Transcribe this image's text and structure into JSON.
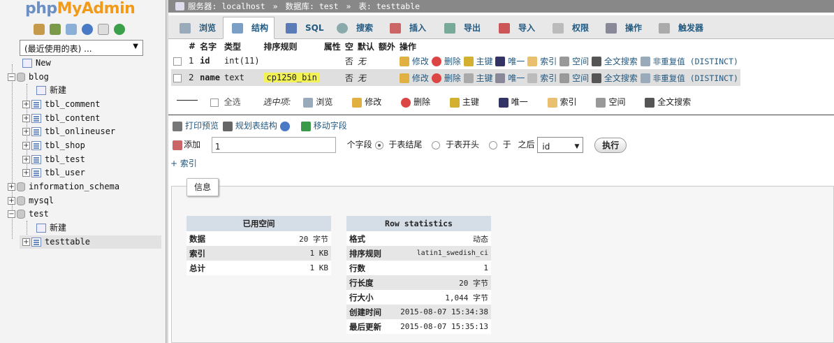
{
  "logo": {
    "php": "php",
    "my": "MyAdmin"
  },
  "nav": {
    "db_select": "(最近使用的表) ..."
  },
  "tree": [
    {
      "label": "New"
    },
    {
      "label": "blog"
    },
    {
      "label": "新建"
    },
    {
      "label": "tbl_comment"
    },
    {
      "label": "tbl_content"
    },
    {
      "label": "tbl_onlineuser"
    },
    {
      "label": "tbl_shop"
    },
    {
      "label": "tbl_test"
    },
    {
      "label": "tbl_user"
    },
    {
      "label": "information_schema"
    },
    {
      "label": "mysql"
    },
    {
      "label": "test"
    },
    {
      "label": "新建"
    },
    {
      "label": "testtable"
    }
  ],
  "breadcrumb": {
    "server": "服务器: localhost",
    "database": "数据库: test",
    "table": "表: testtable",
    "sep": "»"
  },
  "tabs": [
    "浏览",
    "结构",
    "SQL",
    "搜索",
    "插入",
    "导出",
    "导入",
    "权限",
    "操作",
    "触发器"
  ],
  "columns": [
    "#",
    "名字",
    "类型",
    "排序规则",
    "属性",
    "空",
    "默认",
    "额外",
    "操作"
  ],
  "rows": [
    {
      "num": "1",
      "name": "id",
      "type": "int(11)",
      "collation": "",
      "attr": "",
      "null": "否",
      "default": "无",
      "extra": ""
    },
    {
      "num": "2",
      "name": "name",
      "type": "text",
      "collation": "cp1250_bin",
      "attr": "",
      "null": "否",
      "default": "无",
      "extra": ""
    }
  ],
  "row_actions": {
    "edit": "修改",
    "drop": "删除",
    "primary": "主键",
    "unique": "唯一",
    "index": "索引",
    "spatial": "空间",
    "fulltext": "全文搜索",
    "distinct": "非重复值 (DISTINCT)"
  },
  "bulk": {
    "check_all": "全选",
    "with_selected": "选中项:",
    "browse": "浏览",
    "edit": "修改",
    "drop": "删除",
    "primary": "主键",
    "unique": "唯一",
    "index": "索引",
    "spatial": "空间",
    "fulltext": "全文搜索"
  },
  "links": {
    "print": "打印预览",
    "propose": "规划表结构",
    "move": "移动字段"
  },
  "add": {
    "label": "添加",
    "count": "1",
    "fields": "个字段",
    "end": "于表结尾",
    "begin": "于表开头",
    "at": "于",
    "after": "之后",
    "after_col": "id",
    "go": "执行"
  },
  "index_link": "+ 索引",
  "info": {
    "legend": "信息",
    "space": {
      "title": "已用空间",
      "rows": [
        [
          "数据",
          "20 字节"
        ],
        [
          "索引",
          "1 KB"
        ],
        [
          "总计",
          "1 KB"
        ]
      ]
    },
    "stats": {
      "title": "Row statistics",
      "rows": [
        [
          "格式",
          "动态"
        ],
        [
          "排序规则",
          "latin1_swedish_ci"
        ],
        [
          "行数",
          "1"
        ],
        [
          "行长度",
          "20 字节"
        ],
        [
          "行大小",
          "1,044 字节"
        ],
        [
          "创建时间",
          "2015-08-07 15:34:38"
        ],
        [
          "最后更新",
          "2015-08-07 15:35:13"
        ]
      ]
    }
  },
  "colors": {
    "link": "#235a81",
    "highlight": "#f2f256",
    "crumb_bg": "#888888"
  }
}
